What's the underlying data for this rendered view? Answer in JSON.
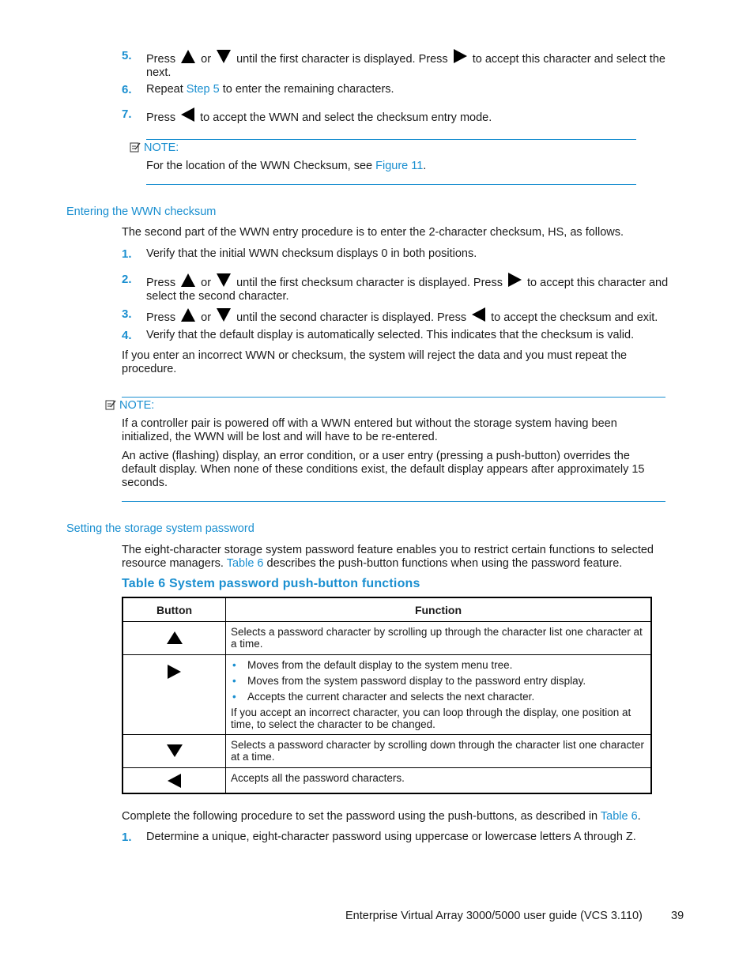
{
  "steps_top": [
    {
      "num": "5.",
      "parts": [
        "Press",
        "or",
        "until the first character is displayed.  Press",
        "to accept this character and select the next."
      ]
    },
    {
      "num": "6.",
      "pre": "Repeat ",
      "link": "Step 5",
      "post": " to enter the remaining characters."
    },
    {
      "num": "7.",
      "pre": "Press",
      "post": "to accept the WWN and select the checksum entry mode."
    }
  ],
  "note1": {
    "label": "NOTE:",
    "pre": "For the location of the WWN Checksum, see ",
    "link": "Figure 11",
    "post": "."
  },
  "section1": {
    "heading": "Entering the WWN checksum",
    "intro": "The second part of the WWN entry procedure is to enter the 2-character checksum, HS, as follows.",
    "steps": [
      {
        "num": "1.",
        "text": "Verify that the initial WWN checksum displays 0 in both positions."
      },
      {
        "num": "2.",
        "parts": [
          "Press",
          "or",
          "until the first checksum character is displayed.  Press",
          "to accept this character and select the second character."
        ]
      },
      {
        "num": "3.",
        "parts": [
          "Press",
          "or",
          "until the second character is displayed.  Press",
          "to accept the checksum and exit."
        ]
      },
      {
        "num": "4.",
        "text": "Verify that the default display is automatically selected.  This indicates that the checksum is valid."
      }
    ],
    "outro": "If you enter an incorrect WWN or checksum, the system will reject the data and you must repeat the procedure."
  },
  "note2": {
    "label": "NOTE:",
    "p1": "If a controller pair is powered off with a WWN entered but without the storage system having been initialized, the WWN will be lost and will have to be re-entered.",
    "p2": "An active (flashing) display, an error condition, or a user entry (pressing a push-button) overrides the default display.  When none of these conditions exist, the default display appears after approximately 15 seconds."
  },
  "section2": {
    "heading": "Setting the storage system password",
    "intro_pre": "The eight-character storage system password feature enables you to restrict certain functions to selected resource managers. ",
    "intro_link": "Table 6",
    "intro_post": " describes the push-button functions when using the password feature.",
    "table_caption": "Table 6 System password push-button functions",
    "table": {
      "headers": [
        "Button",
        "Function"
      ],
      "rows": [
        {
          "button_icon": "up-arrow-icon",
          "text": "Selects a password character by scrolling up through the character list one character at a time."
        },
        {
          "button_icon": "right-arrow-icon",
          "bullets": [
            "Moves from the default display to the system menu tree.",
            "Moves from the system password display to the password entry display.",
            "Accepts the current character and selects the next character."
          ],
          "text": "If you accept an incorrect character, you can loop through the display, one position at time, to select the character to be changed."
        },
        {
          "button_icon": "down-arrow-icon",
          "text": "Selects a password character by scrolling down through the character list one character at a time."
        },
        {
          "button_icon": "left-arrow-icon",
          "text": "Accepts all the password characters."
        }
      ]
    },
    "after_pre": "Complete the following procedure to set the password using the push-buttons, as described in ",
    "after_link": "Table 6",
    "after_post": ".",
    "steps": [
      {
        "num": "1.",
        "text": "Determine a unique, eight-character password using uppercase or lowercase letters A through Z."
      }
    ]
  },
  "footer": {
    "title": "Enterprise Virtual Array 3000/5000 user guide (VCS 3.110)",
    "page": "39"
  }
}
